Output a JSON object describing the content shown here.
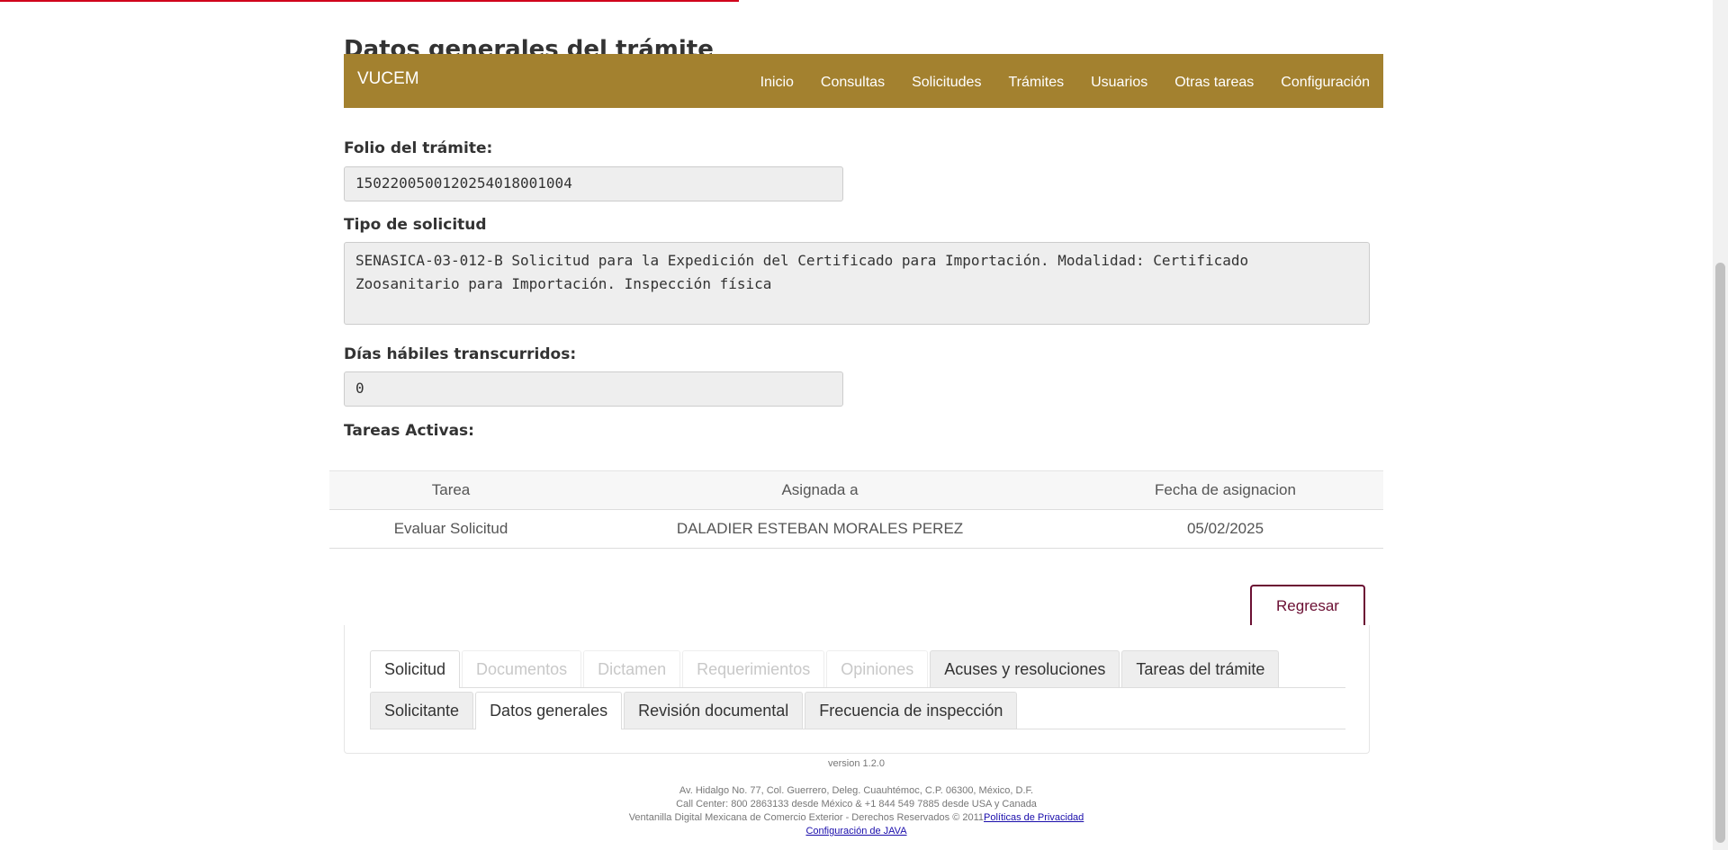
{
  "page": {
    "heading": "Datos generales del trámite"
  },
  "navbar": {
    "brand": "VUCEM",
    "items": [
      "Inicio",
      "Consultas",
      "Solicitudes",
      "Trámites",
      "Usuarios",
      "Otras tareas",
      "Configuración"
    ],
    "color": "#a3812f"
  },
  "form": {
    "folio_label": "Folio del trámite:",
    "folio_value": "1502200500120254018001004",
    "tipo_label": "Tipo de solicitud",
    "tipo_value": "SENASICA-03-012-B Solicitud para la Expedición del Certificado para Importación. Modalidad: Certificado Zoosanitario para Importación. Inspección física",
    "dias_label": "Días hábiles transcurridos:",
    "dias_value": "0",
    "tareas_label": "Tareas Activas:"
  },
  "tasks_table": {
    "headers": [
      "Tarea",
      "Asignada a",
      "Fecha de asignacion"
    ],
    "rows": [
      [
        "Evaluar Solicitud",
        "DALADIER ESTEBAN MORALES PEREZ",
        "05/02/2025"
      ]
    ]
  },
  "actions": {
    "regresar_label": "Regresar"
  },
  "tabs": {
    "row1": [
      {
        "label": "Solicitud",
        "state": "active"
      },
      {
        "label": "Documentos",
        "state": "disabled"
      },
      {
        "label": "Dictamen",
        "state": "disabled"
      },
      {
        "label": "Requerimientos",
        "state": "disabled"
      },
      {
        "label": "Opiniones",
        "state": "disabled"
      },
      {
        "label": "Acuses y resoluciones",
        "state": "normal"
      },
      {
        "label": "Tareas del trámite",
        "state": "normal"
      }
    ],
    "row2": [
      {
        "label": "Solicitante",
        "state": "normal"
      },
      {
        "label": "Datos generales",
        "state": "active"
      },
      {
        "label": "Revisión documental",
        "state": "normal"
      },
      {
        "label": "Frecuencia de inspección",
        "state": "normal"
      }
    ]
  },
  "footer": {
    "version": "version 1.2.0",
    "address": "Av. Hidalgo No. 77, Col. Guerrero, Deleg. Cuauhtémoc, C.P. 06300, México, D.F.",
    "call_center": "Call Center: 800 2863133 desde México & +1 844 549 7885 desde USA y Canada",
    "rights": "Ventanilla Digital Mexicana de Comercio Exterior - Derechos Reservados © 2011",
    "privacy_link": "Políticas de Privacidad",
    "java_link": "Configuración de JAVA"
  }
}
